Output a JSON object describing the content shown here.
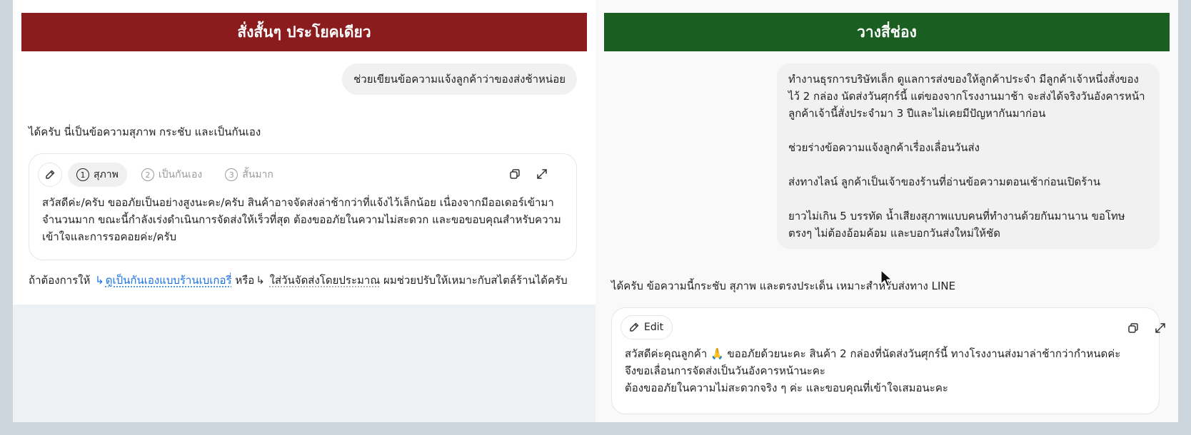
{
  "left_panel": {
    "banner_title": "สั่งสั้นๆ ประโยคเดียว",
    "user_message": "ช่วยเขียนข้อความแจ้งลูกค้าว่าของส่งช้าหน่อย",
    "assistant_intro": "ได้ครับ นี่เป็นข้อความสุภาพ กระชับ และเป็นกันเอง",
    "card": {
      "tabs": [
        {
          "num": "1",
          "label": "สุภาพ"
        },
        {
          "num": "2",
          "label": "เป็นกันเอง"
        },
        {
          "num": "3",
          "label": "สั้นมาก"
        }
      ],
      "body": "สวัสดีค่ะ/ครับ ขออภัยเป็นอย่างสูงนะคะ/ครับ สินค้าอาจจัดส่งล่าช้ากว่าที่แจ้งไว้เล็กน้อย เนื่องจากมีออเดอร์เข้ามาจำนวนมาก ขณะนี้กำลังเร่งดำเนินการจัดส่งให้เร็วที่สุด ต้องขออภัยในความไม่สะดวก และขอขอบคุณสำหรับความเข้าใจและการรอคอยค่ะ/ครับ"
    },
    "followup": {
      "prefix": "ถ้าต้องการให้",
      "link1": "ดูเป็นกันเองแบบร้านเบเกอรี่",
      "middle": "หรือ",
      "link2": "ใส่วันจัดส่งโดยประมาณ",
      "suffix": "ผมช่วยปรับให้เหมาะกับสไตล์ร้านได้ครับ"
    }
  },
  "right_panel": {
    "banner_title": "วางสี่ช่อง",
    "user_message": [
      "ทำงานธุรการบริษัทเล็ก ดูแลการส่งของให้ลูกค้าประจำ มีลูกค้าเจ้าหนึ่งสั่งของไว้ 2 กล่อง นัดส่งวันศุกร์นี้ แต่ของจากโรงงานมาช้า จะส่งได้จริงวันอังคารหน้า ลูกค้าเจ้านี้สั่งประจำมา 3 ปีและไม่เคยมีปัญหากันมาก่อน",
      "ช่วยร่างข้อความแจ้งลูกค้าเรื่องเลื่อนวันส่ง",
      "ส่งทางไลน์ ลูกค้าเป็นเจ้าของร้านที่อ่านข้อความตอนเช้าก่อนเปิดร้าน",
      "ยาวไม่เกิน 5 บรรทัด น้ำเสียงสุภาพแบบคนที่ทำงานด้วยกันมานาน ขอโทษตรงๆ ไม่ต้องอ้อมค้อม และบอกวันส่งใหม่ให้ชัด"
    ],
    "assistant_intro": "ได้ครับ ข้อความนี้กระชับ สุภาพ และตรงประเด็น เหมาะสำหรับส่งทาง LINE",
    "card": {
      "edit_label": "Edit",
      "body_lines": [
        "สวัสดีค่ะคุณลูกค้า 🙏 ขออภัยด้วยนะคะ สินค้า 2 กล่องที่นัดส่งวันศุกร์นี้ ทางโรงงานส่งมาล่าช้ากว่ากำหนดค่ะ",
        "จึงขอเลื่อนการจัดส่งเป็นวันอังคารหน้านะคะ",
        "ต้องขออภัยในความไม่สะดวกจริง ๆ ค่ะ และขอบคุณที่เข้าใจเสมอนะคะ"
      ]
    }
  },
  "icons": {
    "pencil": "pencil-icon",
    "copy": "copy-icon",
    "expand": "expand-icon",
    "reply_arrow": "↳",
    "cursor": "mouse-cursor-icon"
  }
}
